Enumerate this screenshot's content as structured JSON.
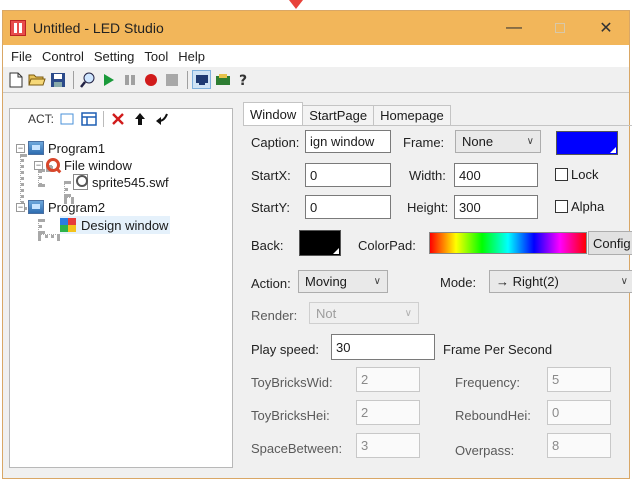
{
  "window": {
    "title": "Untitled - LED Studio"
  },
  "menu": [
    "File",
    "Control",
    "Setting",
    "Tool",
    "Help"
  ],
  "toolbar_icons": [
    "new-file-icon",
    "open-folder-icon",
    "save-icon",
    "preview-icon",
    "play-icon",
    "pause-icon",
    "record-icon",
    "stop-icon",
    "screen-icon",
    "send-icon",
    "help-icon"
  ],
  "left_panel": {
    "act_label": "ACT:",
    "tree": {
      "program1": "Program1",
      "file_window": "File window",
      "sprite": "sprite545.swf",
      "program2": "Program2",
      "design_window": "Design window"
    }
  },
  "tabs": [
    "Window",
    "StartPage",
    "Homepage"
  ],
  "form": {
    "caption_label": "Caption:",
    "caption_value": "ign window",
    "frame_label": "Frame:",
    "frame_value": "None",
    "frame_color": "#0000ff",
    "startx_label": "StartX:",
    "startx_value": "0",
    "width_label": "Width:",
    "width_value": "400",
    "lock_label": "Lock",
    "starty_label": "StartY:",
    "starty_value": "0",
    "height_label": "Height:",
    "height_value": "300",
    "alpha_label": "Alpha",
    "back_label": "Back:",
    "back_color": "#000000",
    "colorpad_label": "ColorPad:",
    "config_label": "Config",
    "action_label": "Action:",
    "action_value": "Moving",
    "mode_label": "Mode:",
    "mode_value": "→ Right(2)",
    "render_label": "Render:",
    "render_value": "Not",
    "playspeed_label": "Play speed:",
    "playspeed_value": "30",
    "fps_label": "Frame Per Second",
    "toybrickswid_label": "ToyBricksWid:",
    "toybrickswid_value": "2",
    "frequency_label": "Frequency:",
    "frequency_value": "5",
    "toybrickshei_label": "ToyBricksHei:",
    "toybrickshei_value": "2",
    "reboundhei_label": "ReboundHei:",
    "reboundhei_value": "0",
    "spacebetween_label": "SpaceBetween:",
    "spacebetween_value": "3",
    "overpass_label": "Overpass:",
    "overpass_value": "8"
  }
}
